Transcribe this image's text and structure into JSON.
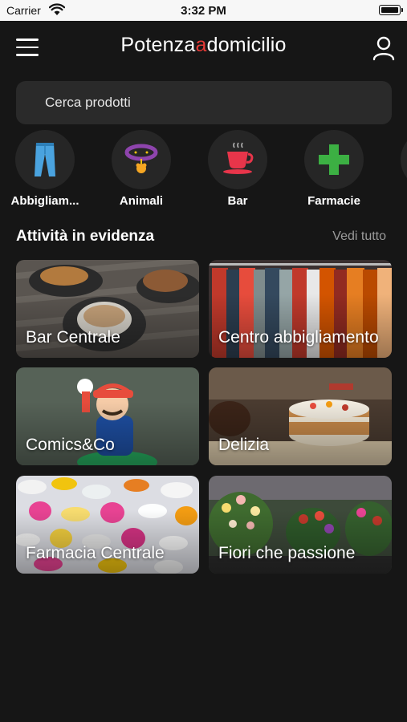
{
  "status_bar": {
    "carrier": "Carrier",
    "time": "3:32 PM"
  },
  "header": {
    "logo_part1": "Potenza",
    "logo_part2": "a",
    "logo_part3": "domicilio",
    "accent_color": "#e53935"
  },
  "search": {
    "placeholder": "Cerca prodotti"
  },
  "categories": [
    {
      "label": "Abbigliam...",
      "icon": "jeans-icon"
    },
    {
      "label": "Animali",
      "icon": "pet-collar-icon"
    },
    {
      "label": "Bar",
      "icon": "coffee-cup-icon"
    },
    {
      "label": "Farmacie",
      "icon": "pharmacy-cross-icon"
    }
  ],
  "featured": {
    "title": "Attività in evidenza",
    "see_all": "Vedi tutto",
    "items": [
      {
        "name": "Bar Centrale"
      },
      {
        "name": "Centro abbigliamento"
      },
      {
        "name": "Comics&Co"
      },
      {
        "name": "Delizia"
      },
      {
        "name": "Farmacia Centrale"
      },
      {
        "name": "Fiori che passione"
      }
    ]
  }
}
